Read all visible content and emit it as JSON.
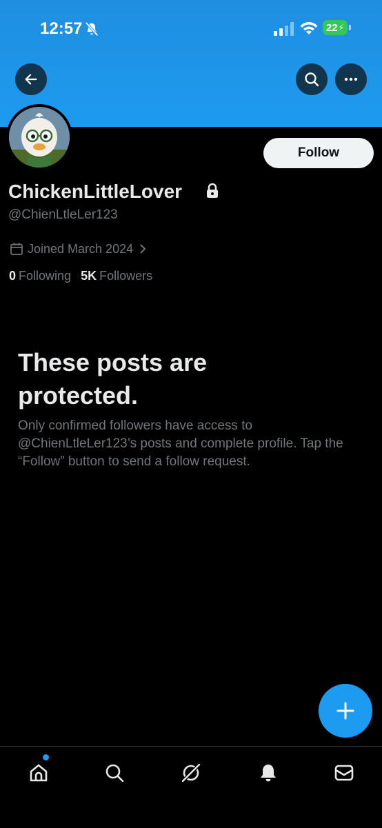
{
  "status_bar": {
    "time": "12:57",
    "battery": "22"
  },
  "profile": {
    "display_name": "ChickenLittleLover",
    "handle": "@ChienLtleLer123",
    "joined": "Joined March 2024",
    "following_count": "0",
    "following_label": "Following",
    "followers_count": "5K",
    "followers_label": "Followers",
    "follow_label": "Follow"
  },
  "protected": {
    "title": "These posts are protected.",
    "description": "Only confirmed followers have access to @ChienLtleLer123’s posts and complete profile. Tap the “Follow” button to send a follow request."
  },
  "colors": {
    "accent": "#1d9bf0",
    "banner": "#1d9bf0",
    "background": "#000000",
    "muted": "#71767b"
  },
  "icons": [
    "arrow-left-icon",
    "search-icon",
    "more-icon",
    "lock-icon",
    "calendar-icon",
    "chevron-right-icon",
    "plus-icon",
    "home-icon",
    "search-icon",
    "grok-icon",
    "bell-icon",
    "mail-icon"
  ]
}
